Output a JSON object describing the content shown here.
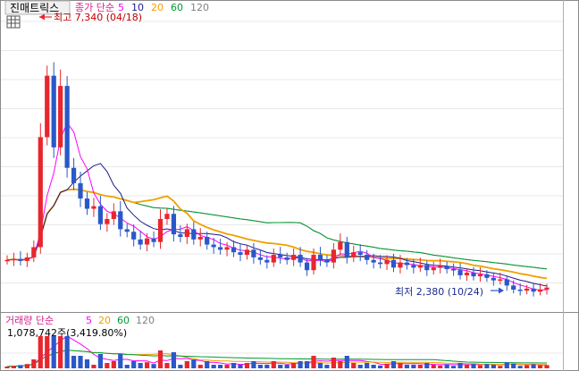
{
  "title": "진매트릭스",
  "price_legend": {
    "label": "종가 단순",
    "periods": [
      "5",
      "10",
      "20",
      "60",
      "120"
    ],
    "colors": [
      "#ff00ff",
      "#1a1a8c",
      "#f0a000",
      "#009933",
      "#808080"
    ]
  },
  "volume_legend": {
    "label": "거래량 단순",
    "periods": [
      "5",
      "20",
      "60",
      "120"
    ],
    "colors": [
      "#ff00ff",
      "#f0a000",
      "#009933",
      "#808080"
    ]
  },
  "volume_readout": "1,078,742주(3,419.80%)",
  "annotations": {
    "high": "최고 7,340 (04/18)",
    "low": "최저 2,380 (10/24)"
  },
  "icons": {
    "table": "table-icon"
  },
  "colors": {
    "up": "#e8262d",
    "down": "#2a58c9",
    "high_arrow": "#e8262d",
    "low_arrow": "#2a58c9"
  },
  "chart_data": {
    "type": "candlestick",
    "y_range": [
      2000,
      7800
    ],
    "high": 7340,
    "low": 2380,
    "close_series": [
      3000,
      3020,
      2980,
      3050,
      3250,
      5400,
      6600,
      5200,
      6400,
      4800,
      4500,
      4200,
      4000,
      4050,
      3700,
      3800,
      3950,
      3600,
      3550,
      3400,
      3300,
      3420,
      3350,
      3800,
      3900,
      3500,
      3450,
      3600,
      3400,
      3450,
      3300,
      3250,
      3200,
      3250,
      3150,
      3100,
      3200,
      3050,
      3000,
      2950,
      3100,
      3050,
      3000,
      3100,
      2950,
      2800,
      3100,
      3000,
      2950,
      3200,
      3350,
      3050,
      3150,
      3100,
      3000,
      2950,
      2920,
      3000,
      2850,
      2950,
      2900,
      2850,
      2900,
      2800,
      2850,
      2880,
      2820,
      2800,
      2700,
      2750,
      2680,
      2720,
      2650,
      2600,
      2620,
      2500,
      2420,
      2400,
      2440,
      2380,
      2420,
      2460
    ]
  }
}
